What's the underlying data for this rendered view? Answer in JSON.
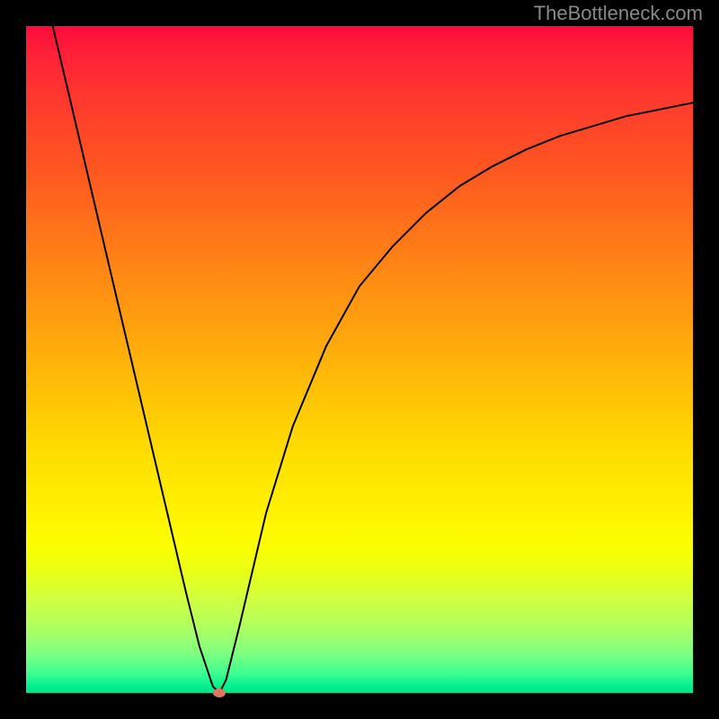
{
  "watermark": "TheBottleneck.com",
  "chart_data": {
    "type": "line",
    "title": "",
    "xlabel": "",
    "ylabel": "",
    "xlim": [
      0,
      100
    ],
    "ylim": [
      0,
      100
    ],
    "series": [
      {
        "name": "bottleneck-curve",
        "x": [
          4,
          8,
          12,
          16,
          20,
          24,
          26,
          28,
          29,
          30,
          32,
          36,
          40,
          45,
          50,
          55,
          60,
          65,
          70,
          75,
          80,
          85,
          90,
          95,
          100
        ],
        "values": [
          100,
          83,
          66,
          49,
          32,
          15,
          7,
          1,
          0,
          2,
          10,
          27,
          40,
          52,
          61,
          67,
          72,
          76,
          79,
          81.5,
          83.5,
          85,
          86.5,
          87.5,
          88.5
        ]
      }
    ],
    "marker": {
      "x": 29,
      "y": 0
    }
  },
  "colors": {
    "curve": "#000000",
    "marker": "#d97a5e",
    "frame": "#000000"
  }
}
